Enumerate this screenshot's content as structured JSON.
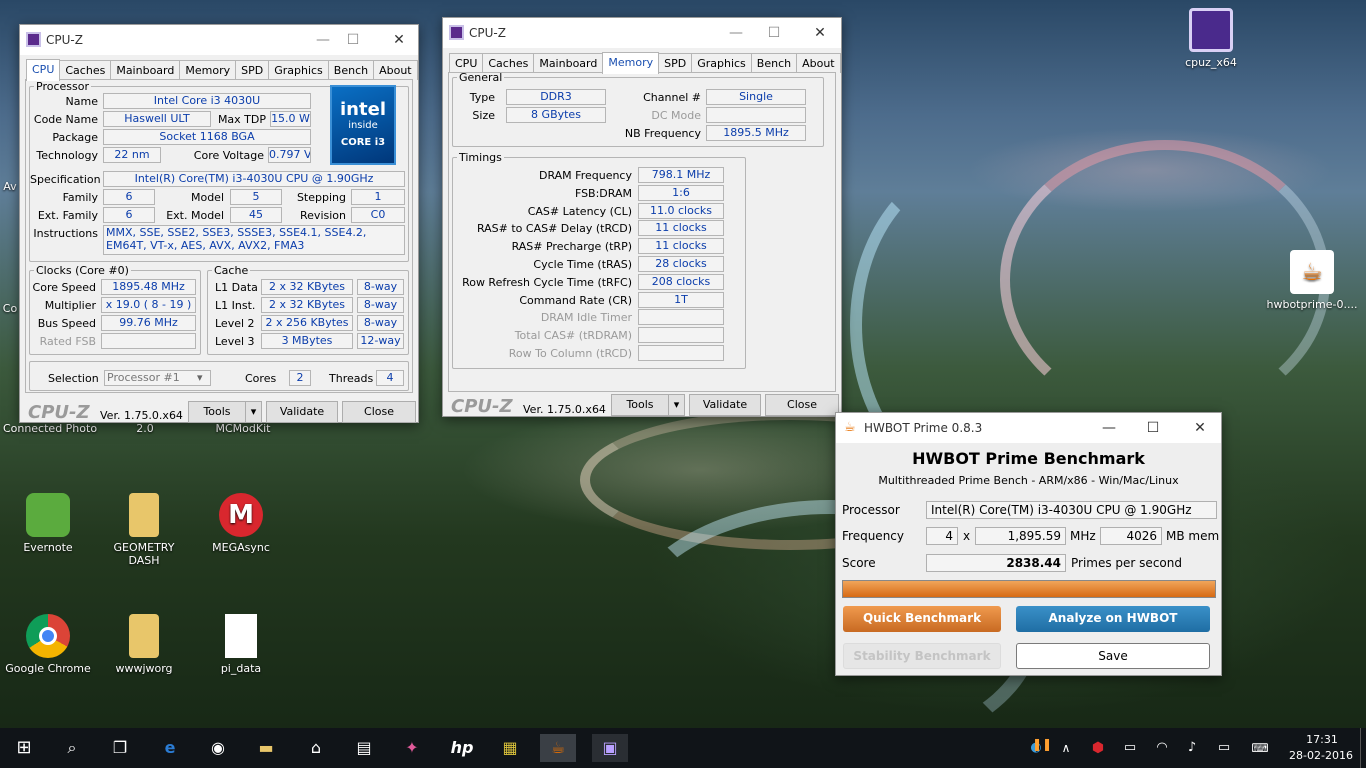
{
  "desktop": {
    "icons_left": [
      {
        "label": "Evernote",
        "color": "#5bab3e"
      },
      {
        "label": "GEOMETRY DASH",
        "color": "#e8c66a"
      },
      {
        "label": "MEGAsync",
        "color": "#d9272e"
      },
      {
        "label": "Google Chrome",
        "color": "#4285f4"
      },
      {
        "label": "wwwjworg",
        "color": "#e8c66a"
      },
      {
        "label": "pi_data",
        "color": "#ffffff"
      }
    ],
    "partial_labels": [
      "Connected Photo",
      "2.0",
      "MCModKit",
      "Co",
      "Av"
    ],
    "icons_right": [
      {
        "label": "cpuz_x64"
      },
      {
        "label": "hwbotprime-0...."
      }
    ]
  },
  "cpuz1": {
    "title": "CPU-Z",
    "tabs": [
      "CPU",
      "Caches",
      "Mainboard",
      "Memory",
      "SPD",
      "Graphics",
      "Bench",
      "About"
    ],
    "active_tab": "CPU",
    "processor": {
      "legend": "Processor",
      "name_label": "Name",
      "name": "Intel Core i3 4030U",
      "codename_label": "Code Name",
      "codename": "Haswell ULT",
      "maxtdp_label": "Max TDP",
      "maxtdp": "15.0 W",
      "package_label": "Package",
      "package": "Socket 1168 BGA",
      "tech_label": "Technology",
      "tech": "22 nm",
      "voltage_label": "Core Voltage",
      "voltage": "0.797 V",
      "spec_label": "Specification",
      "spec": "Intel(R) Core(TM) i3-4030U CPU @ 1.90GHz",
      "family_label": "Family",
      "family": "6",
      "model_label": "Model",
      "model": "5",
      "stepping_label": "Stepping",
      "stepping": "1",
      "extfamily_label": "Ext. Family",
      "extfamily": "6",
      "extmodel_label": "Ext. Model",
      "extmodel": "45",
      "revision_label": "Revision",
      "revision": "C0",
      "instr_label": "Instructions",
      "instr": "MMX, SSE, SSE2, SSE3, SSSE3, SSE4.1, SSE4.2, EM64T, VT-x, AES, AVX, AVX2, FMA3"
    },
    "intel_logo": {
      "top": "intel",
      "mid": "inside",
      "bottom": "CORE i3"
    },
    "clocks": {
      "legend": "Clocks (Core #0)",
      "speed_label": "Core Speed",
      "speed": "1895.48 MHz",
      "mult_label": "Multiplier",
      "mult": "x 19.0 ( 8 - 19 )",
      "bus_label": "Bus Speed",
      "bus": "99.76 MHz",
      "fsb_label": "Rated FSB",
      "fsb": ""
    },
    "cache": {
      "legend": "Cache",
      "rows": [
        {
          "label": "L1 Data",
          "size": "2 x 32 KBytes",
          "way": "8-way"
        },
        {
          "label": "L1 Inst.",
          "size": "2 x 32 KBytes",
          "way": "8-way"
        },
        {
          "label": "Level 2",
          "size": "2 x 256 KBytes",
          "way": "8-way"
        },
        {
          "label": "Level 3",
          "size": "3 MBytes",
          "way": "12-way"
        }
      ]
    },
    "selection_label": "Selection",
    "selection": "Processor #1",
    "cores_label": "Cores",
    "cores": "2",
    "threads_label": "Threads",
    "threads": "4",
    "footer": {
      "logo": "CPU-Z",
      "version": "Ver. 1.75.0.x64",
      "tools": "Tools",
      "validate": "Validate",
      "close": "Close"
    }
  },
  "cpuz2": {
    "title": "CPU-Z",
    "tabs": [
      "CPU",
      "Caches",
      "Mainboard",
      "Memory",
      "SPD",
      "Graphics",
      "Bench",
      "About"
    ],
    "active_tab": "Memory",
    "general": {
      "legend": "General",
      "type_label": "Type",
      "type": "DDR3",
      "size_label": "Size",
      "size": "8 GBytes",
      "channel_label": "Channel #",
      "channel": "Single",
      "dcmode_label": "DC Mode",
      "dcmode": "",
      "nbfreq_label": "NB Frequency",
      "nbfreq": "1895.5 MHz"
    },
    "timings": {
      "legend": "Timings",
      "rows": [
        {
          "label": "DRAM Frequency",
          "value": "798.1 MHz",
          "dim": false
        },
        {
          "label": "FSB:DRAM",
          "value": "1:6",
          "dim": false
        },
        {
          "label": "CAS# Latency (CL)",
          "value": "11.0 clocks",
          "dim": false
        },
        {
          "label": "RAS# to CAS# Delay (tRCD)",
          "value": "11 clocks",
          "dim": false
        },
        {
          "label": "RAS# Precharge (tRP)",
          "value": "11 clocks",
          "dim": false
        },
        {
          "label": "Cycle Time (tRAS)",
          "value": "28 clocks",
          "dim": false
        },
        {
          "label": "Row Refresh Cycle Time (tRFC)",
          "value": "208 clocks",
          "dim": false
        },
        {
          "label": "Command Rate (CR)",
          "value": "1T",
          "dim": false
        },
        {
          "label": "DRAM Idle Timer",
          "value": "",
          "dim": true
        },
        {
          "label": "Total CAS# (tRDRAM)",
          "value": "",
          "dim": true
        },
        {
          "label": "Row To Column (tRCD)",
          "value": "",
          "dim": true
        }
      ]
    },
    "footer": {
      "logo": "CPU-Z",
      "version": "Ver. 1.75.0.x64",
      "tools": "Tools",
      "validate": "Validate",
      "close": "Close"
    }
  },
  "hwbot": {
    "title": "HWBOT Prime 0.8.3",
    "heading": "HWBOT Prime Benchmark",
    "subheading": "Multithreaded Prime Bench - ARM/x86 - Win/Mac/Linux",
    "processor_label": "Processor",
    "processor": "Intel(R) Core(TM) i3-4030U CPU @ 1.90GHz",
    "frequency_label": "Frequency",
    "threads": "4",
    "x": "x",
    "freq": "1,895.59",
    "mhz": "MHz",
    "mem": "4026",
    "mbmem": "MB mem",
    "score_label": "Score",
    "score": "2838.44",
    "pps": "Primes per second",
    "progress": 1.0,
    "quick": "Quick Benchmark",
    "analyze": "Analyze on HWBOT",
    "stability": "Stability Benchmark",
    "save": "Save"
  },
  "taskbar": {
    "time": "17:31",
    "date": "28-02-2016"
  },
  "colors": {
    "accent_orange": "#e0863a",
    "accent_blue": "#2c7fb8",
    "value_blue": "#0b3dab",
    "taskbar": "#101418"
  }
}
